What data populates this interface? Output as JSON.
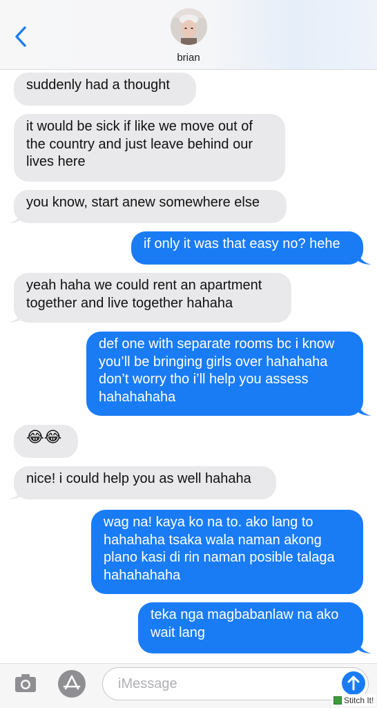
{
  "header": {
    "contact_name": "brian"
  },
  "messages": [
    {
      "id": "m1",
      "direction": "incoming",
      "text": "suddenly had a thought"
    },
    {
      "id": "m2",
      "direction": "incoming",
      "text": "it would be sick if like we move out of the country and just leave behind our lives here"
    },
    {
      "id": "m3",
      "direction": "incoming",
      "text": "you know, start anew somewhere else"
    },
    {
      "id": "m4",
      "direction": "outgoing",
      "text": "if only it was that easy no? hehe"
    },
    {
      "id": "m5",
      "direction": "incoming",
      "text": "yeah haha we could rent an apartment together and live together hahaha"
    },
    {
      "id": "m6",
      "direction": "outgoing",
      "text": "def one with separate rooms bc i know you’ll be bringing girls over hahahaha don’t worry tho i’ll help you assess hahahahaha"
    },
    {
      "id": "m7",
      "direction": "incoming",
      "text": "😂😂"
    },
    {
      "id": "m8",
      "direction": "incoming",
      "text": "nice! i could help you as well hahaha"
    },
    {
      "id": "m9",
      "direction": "outgoing",
      "text": "wag na! kaya ko na to. ako lang to hahahaha tsaka wala naman akong plano kasi di rin naman posible talaga hahahahaha"
    },
    {
      "id": "m10",
      "direction": "outgoing",
      "text": "teka nga magbabanlaw na ako wait lang"
    }
  ],
  "composer": {
    "placeholder": "iMessage"
  },
  "watermark": {
    "text": "Stitch It!"
  },
  "colors": {
    "incoming_bubble": "#e9e9eb",
    "outgoing_bubble": "#1a7cf5",
    "accent": "#1a7cf5"
  },
  "icons": [
    "chevron-left-icon",
    "camera-icon",
    "app-store-icon",
    "send-arrow-icon"
  ]
}
